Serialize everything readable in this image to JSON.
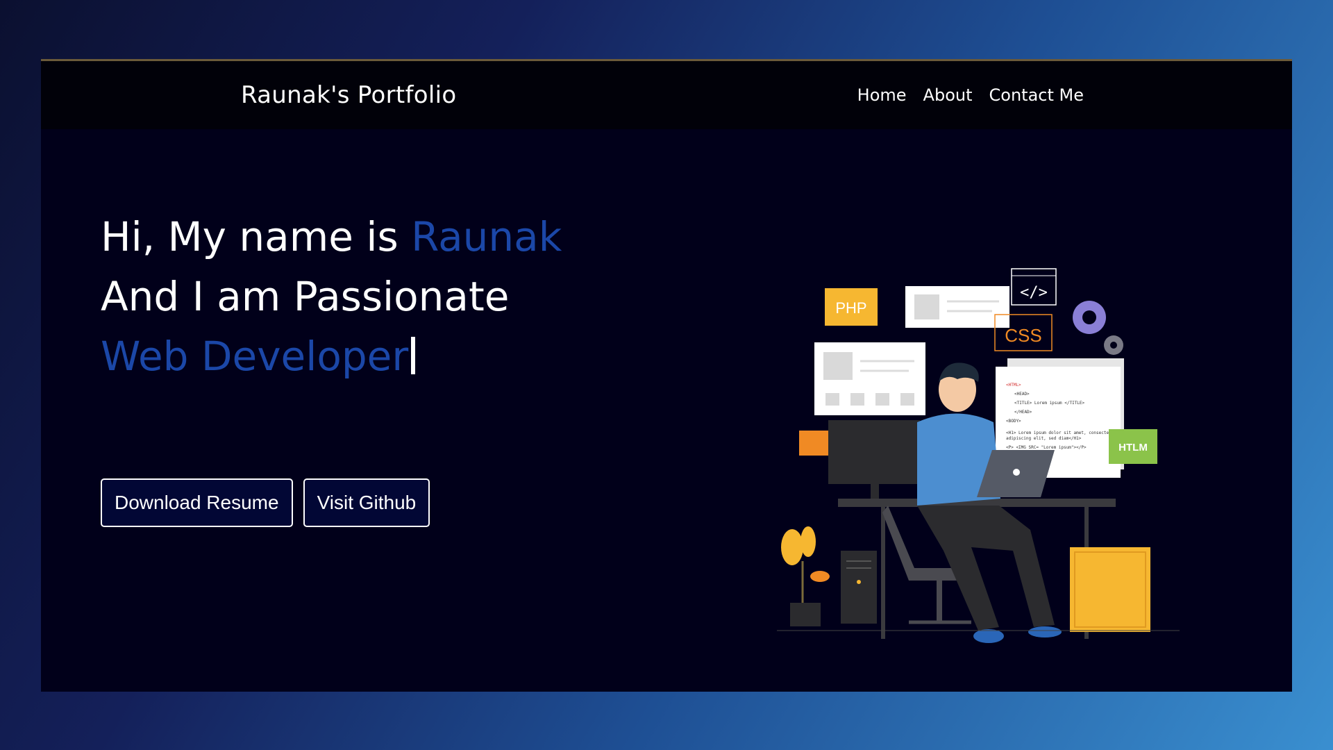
{
  "navbar": {
    "brand": "Raunak's Portfolio",
    "links": [
      "Home",
      "About",
      "Contact Me"
    ]
  },
  "hero": {
    "intro": "Hi, My name is ",
    "name": "Raunak",
    "line2": "And I am Passionate",
    "role": "Web Developer"
  },
  "buttons": {
    "resume": "Download Resume",
    "github": "Visit Github"
  },
  "illustration": {
    "php": "PHP",
    "css": "CSS",
    "htlm": "HTLM",
    "code_lines": [
      "<HTML>",
      "<HEAD>",
      "<TITLE> Lorem ipsum </TITLE>",
      "</HEAD>",
      "<BODY>",
      "<H1> Lorem ipsum dolor sit amet, consectetur",
      "adipiscing elit, sed diam</H1>",
      "<P> <IMG SRC= \"Lorem ipsum\"></P>"
    ]
  },
  "colors": {
    "accent": "#1b47a8",
    "page_bg": "#01001a",
    "navbar_bg": "#010109",
    "php_tag": "#f6b731",
    "css_tag": "#f08a24",
    "htlm_tag": "#8bc34a",
    "shirt": "#4c8ed0"
  }
}
